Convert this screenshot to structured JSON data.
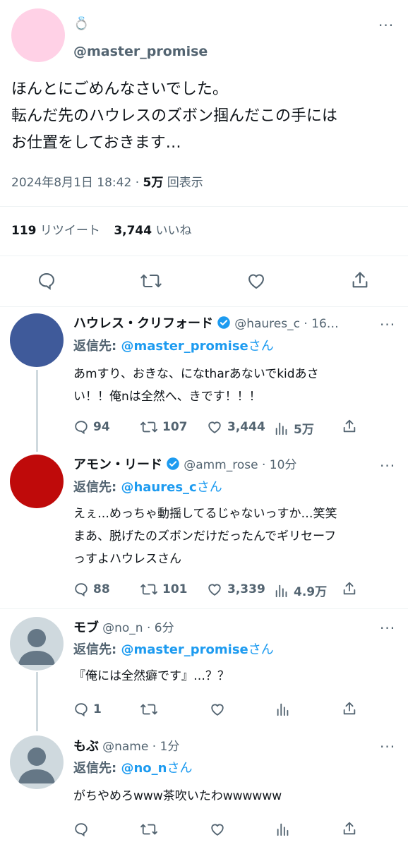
{
  "main_tweet": {
    "display_name_emoji": "💍",
    "handle": "@master_promise",
    "text_lines": [
      "ほんとにごめんなさいでした。",
      "転んだ先のハウレスのズボン掴んだこの手には",
      "お仕置をしておきます…"
    ],
    "date": "2024年8月1日 18:42",
    "separator": "·",
    "views_count": "5万",
    "views_label": "回表示",
    "retweets_count": "119",
    "retweets_label": "リツイート",
    "likes_count": "3,744",
    "likes_label": "いいね"
  },
  "replies": [
    {
      "name": "ハウレス・クリフォード",
      "verified": true,
      "handle_time": "@haures_c · 16…",
      "reply_to_prefix": "返信先: ",
      "reply_to_handle": "@master_promise",
      "reply_to_suffix": "さん",
      "text_lines": [
        "あmすり、おきな、になtharあないでkidあさ",
        "い！！俺nは全然へ、きです！！！"
      ],
      "replies": "94",
      "retweets": "107",
      "likes": "3,444",
      "views": "5万",
      "avatar_color": "#3f5a9a"
    },
    {
      "name": "アモン・リード",
      "verified": true,
      "handle_time": "@amm_rose · 10分",
      "reply_to_prefix": "返信先: ",
      "reply_to_handle": "@haures_c",
      "reply_to_suffix": "さん",
      "text_lines": [
        "えぇ…めっちゃ動揺してるじゃないっすか…笑笑",
        "まあ、脱げたのズボンだけだったんでギリセーフ",
        "っすよハウレスさん"
      ],
      "replies": "88",
      "retweets": "101",
      "likes": "3,339",
      "views": "4.9万",
      "avatar_color": "#bf0a0a"
    },
    {
      "name": "モブ",
      "verified": false,
      "handle_time": "@no_n · 6分",
      "reply_to_prefix": "返信先: ",
      "reply_to_handle": "@master_promise",
      "reply_to_suffix": "さん",
      "text_lines": [
        "『俺には全然癖です』…？？"
      ],
      "replies": "1",
      "retweets": "",
      "likes": "",
      "views": "",
      "avatar_color": "#cfd9de"
    },
    {
      "name": "もぶ",
      "verified": false,
      "handle_time": "@name · 1分",
      "reply_to_prefix": "返信先: ",
      "reply_to_handle": "@no_n",
      "reply_to_suffix": "さん",
      "text_lines": [
        "がちやめろwww茶吹いたわwwwwww"
      ],
      "replies": "",
      "retweets": "",
      "likes": "",
      "views": "",
      "avatar_color": "#cfd9de"
    }
  ],
  "icons": {
    "more": "more-icon",
    "reply": "reply-icon",
    "retweet": "retweet-icon",
    "like": "heart-icon",
    "views": "views-icon",
    "share": "share-icon",
    "verified": "verified-badge-icon"
  },
  "colors": {
    "accent": "#1d9bf0",
    "muted": "#536471",
    "main_avatar": "#ffd1e6"
  }
}
